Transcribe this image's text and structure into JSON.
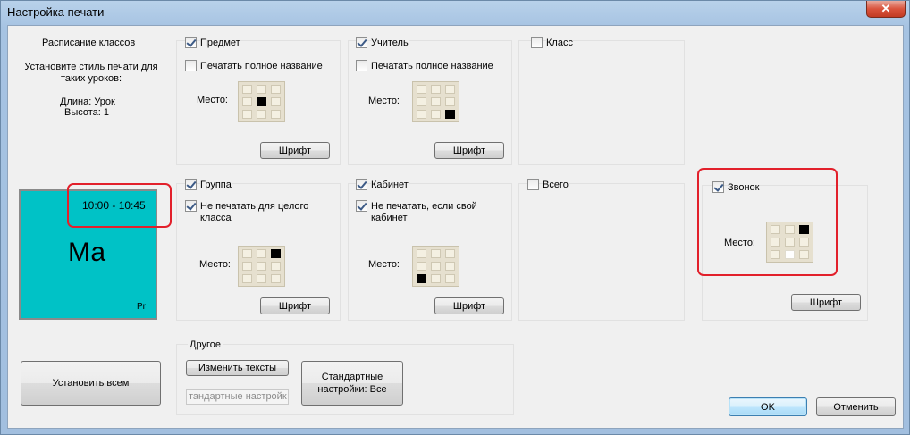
{
  "window": {
    "title": "Настройка печати",
    "close_glyph": "✕"
  },
  "info": {
    "heading": "Расписание классов",
    "style_text": "Установите стиль печати для таких уроков:",
    "length": "Длина: Урок",
    "height": "Высота: 1"
  },
  "preview": {
    "time": "10:00 - 10:45",
    "subject": "Ма",
    "room": "Pr",
    "bg_color": "#00c2c6"
  },
  "common": {
    "place_label": "Место:",
    "font_button": "Шрифт"
  },
  "sections": {
    "subject": {
      "label": "Предмет",
      "checked": true,
      "option": "Печатать полное название",
      "option_checked": false
    },
    "teacher": {
      "label": "Учитель",
      "checked": true,
      "option": "Печатать полное название",
      "option_checked": false
    },
    "class": {
      "label": "Класс",
      "checked": false
    },
    "group": {
      "label": "Группа",
      "checked": true,
      "option": "Не печатать для целого класса",
      "option_checked": true
    },
    "room": {
      "label": "Кабинет",
      "checked": true,
      "option": "Не печатать, если свой кабинет",
      "option_checked": true
    },
    "total": {
      "label": "Всего",
      "checked": false
    },
    "bell": {
      "label": "Звонок",
      "checked": true
    }
  },
  "other": {
    "heading": "Другое",
    "change_texts": "Изменить тексты",
    "standard_settings_field": "тандартные настройк",
    "standard_all": "Стандартные настройки: Все"
  },
  "buttons": {
    "set_all": "Установить всем",
    "ok": "OK",
    "cancel": "Отменить"
  }
}
